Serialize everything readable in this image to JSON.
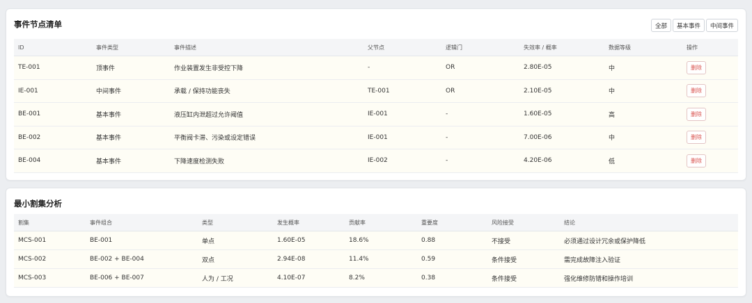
{
  "nodes": {
    "title": "事件节点清单",
    "filters": [
      "全部",
      "基本事件",
      "中间事件"
    ],
    "columns": [
      "ID",
      "事件类型",
      "事件描述",
      "父节点",
      "逻辑门",
      "失效率 / 概率",
      "数据等级",
      "操作"
    ],
    "rows": [
      [
        "TE-001",
        "顶事件",
        "作业装置发生非受控下降",
        "-",
        "OR",
        "2.80E-05",
        "中"
      ],
      [
        "IE-001",
        "中间事件",
        "承载 / 保持功能丧失",
        "TE-001",
        "OR",
        "2.10E-05",
        "中"
      ],
      [
        "BE-001",
        "基本事件",
        "液压缸内泄超过允许阈值",
        "IE-001",
        "-",
        "1.60E-05",
        "高"
      ],
      [
        "BE-002",
        "基本事件",
        "平衡阀卡滞、污染或设定错误",
        "IE-001",
        "-",
        "7.00E-06",
        "中"
      ],
      [
        "BE-004",
        "基本事件",
        "下降速度检测失败",
        "IE-002",
        "-",
        "4.20E-06",
        "低"
      ]
    ],
    "delete_label": "删除"
  },
  "cutsets": {
    "title": "最小割集分析",
    "columns": [
      "割集",
      "事件组合",
      "类型",
      "发生概率",
      "贡献率",
      "重要度",
      "风险接受",
      "结论"
    ],
    "rows": [
      [
        "MCS-001",
        "BE-001",
        "单点",
        "1.60E-05",
        "18.6%",
        "0.88",
        "不接受",
        "必须通过设计冗余或保护降低"
      ],
      [
        "MCS-002",
        "BE-002 + BE-004",
        "双点",
        "2.94E-08",
        "11.4%",
        "0.59",
        "条件接受",
        "需完成故障注入验证"
      ],
      [
        "MCS-003",
        "BE-006 + BE-007",
        "人为 / 工况",
        "4.10E-07",
        "8.2%",
        "0.38",
        "条件接受",
        "强化维修防错和操作培训"
      ]
    ]
  }
}
